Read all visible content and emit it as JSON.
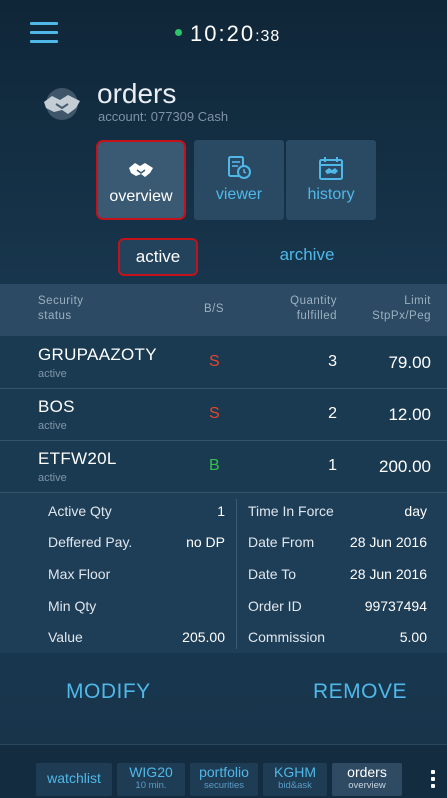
{
  "clock": {
    "time": "10:20",
    "seconds": ":38",
    "status_color": "#2ec46a"
  },
  "header": {
    "title": "orders",
    "account": "account: 077309 Cash"
  },
  "tabs": [
    {
      "label": "overview",
      "icon": "handshake-icon",
      "selected": true
    },
    {
      "label": "viewer",
      "icon": "document-clock-icon",
      "selected": false
    },
    {
      "label": "history",
      "icon": "calendar-icon",
      "selected": false
    }
  ],
  "segments": {
    "active": "active",
    "archive": "archive"
  },
  "table": {
    "headers": {
      "security": "Security",
      "status": "status",
      "bs": "B/S",
      "quantity": "Quantity",
      "fulfilled": "fulfilled",
      "limit": "Limit",
      "stppx": "StpPx/Peg"
    },
    "rows": [
      {
        "symbol": "GRUPAAZOTY",
        "status": "active",
        "bs": "S",
        "quantity": "3",
        "limit": "79.00"
      },
      {
        "symbol": "BOS",
        "status": "active",
        "bs": "S",
        "quantity": "2",
        "limit": "12.00"
      },
      {
        "symbol": "ETFW20L",
        "status": "active",
        "bs": "B",
        "quantity": "1",
        "limit": "200.00"
      }
    ]
  },
  "details": {
    "left": [
      {
        "label": "Active Qty",
        "value": "1"
      },
      {
        "label": "Deffered Pay.",
        "value": "no DP"
      },
      {
        "label": "Max Floor",
        "value": ""
      },
      {
        "label": "Min Qty",
        "value": ""
      },
      {
        "label": "Value",
        "value": "205.00"
      }
    ],
    "right": [
      {
        "label": "Time In Force",
        "value": "day"
      },
      {
        "label": "Date From",
        "value": "28 Jun 2016"
      },
      {
        "label": "Date To",
        "value": "28 Jun 2016"
      },
      {
        "label": "Order ID",
        "value": "99737494"
      },
      {
        "label": "Commission",
        "value": "5.00"
      }
    ]
  },
  "actions": {
    "modify": "MODIFY",
    "remove": "REMOVE"
  },
  "bottom_nav": [
    {
      "label": "watchlist",
      "sub": ""
    },
    {
      "label": "WIG20",
      "sub": "10 min."
    },
    {
      "label": "portfolio",
      "sub": "securities"
    },
    {
      "label": "KGHM",
      "sub": "bid&ask"
    },
    {
      "label": "orders",
      "sub": "overview",
      "selected": true
    }
  ],
  "colors": {
    "sell": "#e8452c",
    "buy": "#35c24a",
    "accent": "#4fb8e8",
    "highlight": "#c4121a"
  }
}
